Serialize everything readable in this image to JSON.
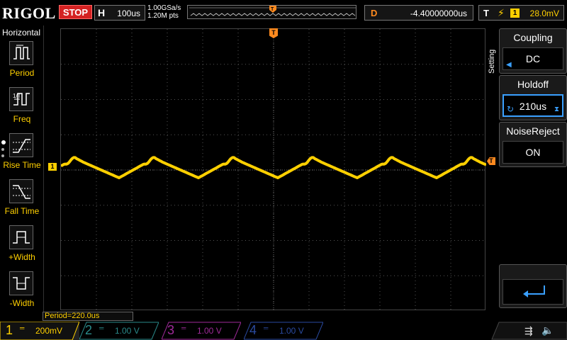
{
  "header": {
    "logo": "RIGOL",
    "run_state": "STOP",
    "timebase_label": "H",
    "timebase_value": "100us",
    "sample_rate": "1.00GSa/s",
    "memory_depth": "1.20M pts",
    "delay_label": "D",
    "delay_value": "-4.40000000us",
    "trigger_label": "T",
    "trigger_source": "1",
    "trigger_level": "28.0mV",
    "colors": {
      "stop": "#d42222",
      "ch1": "#ffd000",
      "trigger": "#ff8a1f"
    }
  },
  "left_menu": {
    "title": "Horizontal",
    "items": [
      {
        "label": "Period",
        "icon": "period-icon"
      },
      {
        "label": "Freq",
        "icon": "frequency-icon"
      },
      {
        "label": "Rise Time",
        "icon": "rise-time-icon"
      },
      {
        "label": "Fall Time",
        "icon": "fall-time-icon"
      },
      {
        "label": "+Width",
        "icon": "positive-width-icon"
      },
      {
        "label": "-Width",
        "icon": "negative-width-icon"
      }
    ]
  },
  "waveform": {
    "channel": "1",
    "color": "#ffd000",
    "trigger_marker": "T"
  },
  "measurement": {
    "text": "Period=220.0us"
  },
  "right_menu": {
    "side_label": "Setting",
    "coupling": {
      "title": "Coupling",
      "value": "DC"
    },
    "holdoff": {
      "title": "Holdoff",
      "value": "210us"
    },
    "noise_reject": {
      "title": "NoiseReject",
      "value": "ON"
    }
  },
  "channels": [
    {
      "num": "1",
      "value": "200mV",
      "color": "#ffd000",
      "active": true
    },
    {
      "num": "2",
      "value": "1.00 V",
      "color": "#2a8a8a",
      "active": false
    },
    {
      "num": "3",
      "value": "1.00 V",
      "color": "#a02a9a",
      "active": false
    },
    {
      "num": "4",
      "value": "1.00 V",
      "color": "#2a4aa0",
      "active": false
    }
  ]
}
